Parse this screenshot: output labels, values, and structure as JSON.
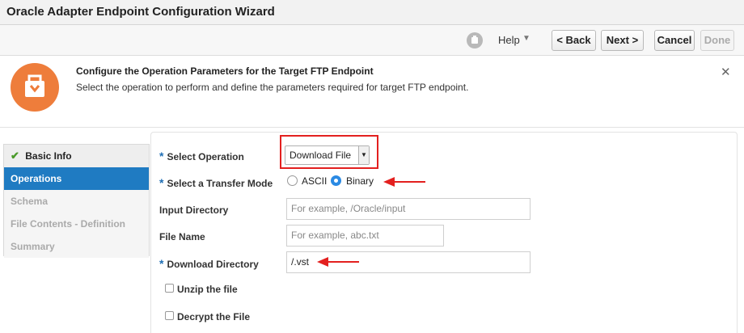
{
  "window": {
    "title": "Oracle Adapter Endpoint Configuration Wizard"
  },
  "toolbar": {
    "help_label": "Help",
    "back_label": "< Back",
    "next_label": "Next >",
    "cancel_label": "Cancel",
    "done_label": "Done",
    "help_icon": "gray-info-icon",
    "help_caret_icon": "triangle-down-icon"
  },
  "header": {
    "title": "Configure the Operation Parameters for the Target FTP Endpoint",
    "description": "Select the operation to perform and define the parameters required for target FTP endpoint.",
    "icon": "orange-adapter-icon",
    "close_icon": "close-icon"
  },
  "sidebar": {
    "items": [
      {
        "label": "Basic Info",
        "state": "completed"
      },
      {
        "label": "Operations",
        "state": "active"
      },
      {
        "label": "Schema",
        "state": "disabled"
      },
      {
        "label": "File Contents - Definition",
        "state": "disabled"
      },
      {
        "label": "Summary",
        "state": "disabled"
      }
    ]
  },
  "form": {
    "select_operation": {
      "label": "Select Operation",
      "required": true,
      "value": "Download File"
    },
    "transfer_mode": {
      "label": "Select a Transfer Mode",
      "required": true,
      "options": [
        {
          "label": "ASCII",
          "checked": false
        },
        {
          "label": "Binary",
          "checked": true
        }
      ]
    },
    "input_directory": {
      "label": "Input Directory",
      "placeholder": "For example, /Oracle/input",
      "value": ""
    },
    "file_name": {
      "label": "File Name",
      "placeholder": "For example, abc.txt",
      "value": ""
    },
    "download_directory": {
      "label": "Download Directory",
      "required": true,
      "value": "/.vst"
    },
    "unzip": {
      "label": "Unzip the file",
      "checked": false
    },
    "decrypt": {
      "label": "Decrypt the File",
      "checked": false
    }
  },
  "colors": {
    "accent": "#1f7bc2",
    "required": "#1f6fb5",
    "annotation": "#e3201f",
    "header_icon": "#ee7d3b"
  }
}
